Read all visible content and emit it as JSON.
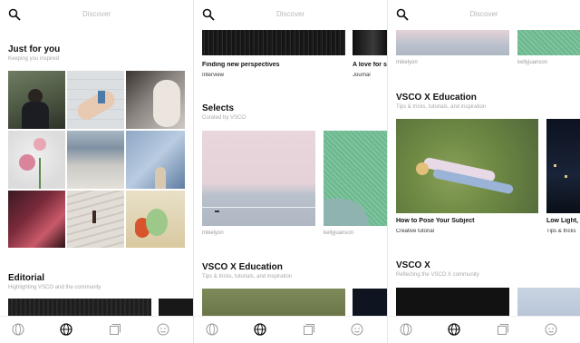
{
  "screens": [
    {
      "header": {
        "title": "Discover",
        "icons": [
          "search-icon"
        ]
      },
      "sections": [
        {
          "title": "Just for you",
          "subtitle": "Keeping you inspired"
        },
        {
          "title": "Editorial",
          "subtitle": "Highlighting VSCO and the community"
        }
      ],
      "nav": [
        "globe-outline-icon",
        "globe-icon",
        "gallery-icon",
        "face-icon"
      ]
    },
    {
      "header": {
        "title": "Discover",
        "icons": [
          "search-icon"
        ]
      },
      "cards": [
        {
          "title": "Finding new perspectives",
          "subtitle": "Interview"
        },
        {
          "title": "A love for s",
          "subtitle": "Journal"
        }
      ],
      "sections": [
        {
          "title": "Selects",
          "subtitle": "Curated by VSCO"
        },
        {
          "title": "VSCO X Education",
          "subtitle": "Tips & tricks, tutorials, and inspiration"
        }
      ],
      "captions": [
        "mikelyon",
        "kellyjuanson"
      ]
    },
    {
      "header": {
        "title": "Discover",
        "icons": [
          "search-icon"
        ]
      },
      "captions": [
        "mikelyon",
        "kellyjuanson"
      ],
      "sections": [
        {
          "title": "VSCO X Education",
          "subtitle": "Tips & tricks, tutorials, and inspiration"
        },
        {
          "title": "VSCO X",
          "subtitle": "Reflecting the VSCO X community"
        }
      ],
      "cards": [
        {
          "title": "How to Pose Your Subject",
          "subtitle": "Creative tutorial"
        },
        {
          "title": "Low Light,",
          "subtitle": "Tips & tricks"
        }
      ]
    }
  ],
  "colors": {
    "accent": "#111111",
    "muted": "#a8a8a8",
    "background": "#ffffff"
  }
}
